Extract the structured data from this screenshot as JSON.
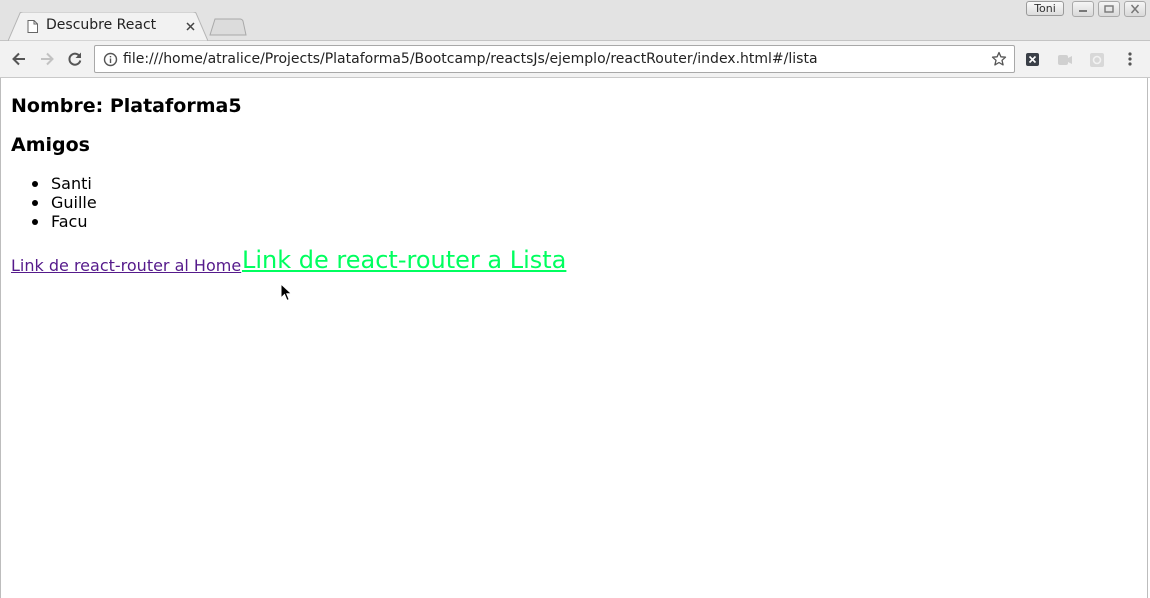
{
  "browser": {
    "tab": {
      "title": "Descubre React",
      "page_icon": "page-icon",
      "close_icon": "close-icon"
    },
    "new_tab_icon": "new-tab-icon",
    "profile": {
      "name": "Toni"
    },
    "window_controls": [
      "minimize-icon",
      "restore-icon",
      "close-icon"
    ],
    "toolbar": {
      "back_icon": "back-arrow-icon",
      "forward_icon": "forward-arrow-icon",
      "reload_icon": "reload-icon",
      "info_icon": "info-icon",
      "url": "file:///home/atralice/Projects/Plataforma5/Bootcamp/reactsJs/ejemplo/reactRouter/index.html#/lista",
      "bookmark_icon": "star-icon",
      "extensions": [
        "extension-x-icon",
        "extension-video-icon",
        "extension-gear-icon"
      ],
      "menu_icon": "kebab-menu-icon"
    }
  },
  "page": {
    "nombre_label": "Nombre:",
    "nombre_value": "Plataforma5",
    "amigos_heading": "Amigos",
    "friends": [
      "Santi",
      "Guille",
      "Facu"
    ],
    "link_home": "Link de react-router al Home",
    "link_lista": "Link de react-router a Lista"
  },
  "colors": {
    "visited_link": "#551a8b",
    "active_link": "#00ff5f"
  }
}
